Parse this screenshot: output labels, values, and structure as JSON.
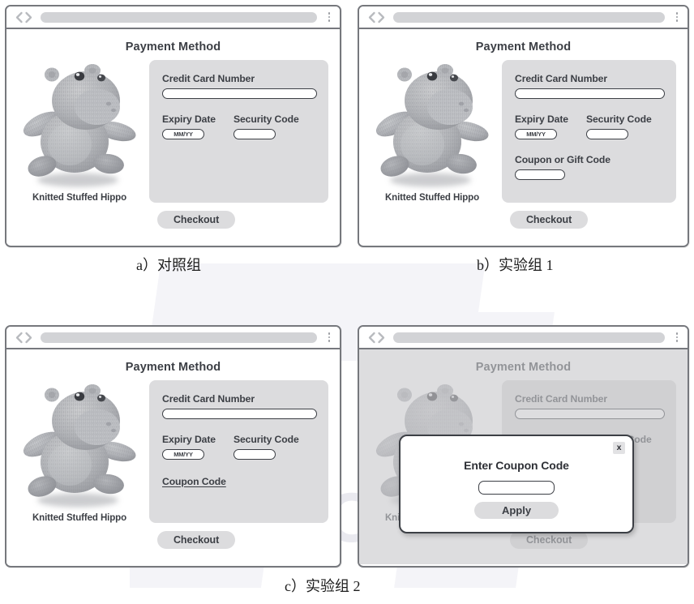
{
  "figure": {
    "captions": {
      "a": "a）对照组",
      "b": "b）实验组 1",
      "c": "c）实验组 2"
    },
    "watermark": "HZ BOOKS"
  },
  "browser": {
    "back_icon": "chevron-left-icon",
    "forward_icon": "chevron-right-icon",
    "url_value": "",
    "menu_icon": "kebab-menu-icon"
  },
  "common": {
    "page_title": "Payment Method",
    "product_caption": "Knitted Stuffed Hippo",
    "product_image": "knitted-stuffed-hippo-photo",
    "checkout_label": "Checkout",
    "credit_card_label": "Credit Card Number",
    "expiry_label": "Expiry Date",
    "expiry_placeholder": "MM/YY",
    "security_label": "Security Code",
    "card_value": "",
    "expiry_value": "",
    "security_value": ""
  },
  "panel_a": {
    "id": "control-group"
  },
  "panel_b": {
    "id": "experiment-group-1",
    "coupon_label": "Coupon or Gift Code",
    "coupon_value": ""
  },
  "panel_c": {
    "id": "experiment-group-2",
    "coupon_link_label": "Coupon Code"
  },
  "panel_d": {
    "id": "experiment-group-2-modal",
    "modal_title": "Enter Coupon Code",
    "modal_close_label": "x",
    "modal_input_value": "",
    "modal_apply_label": "Apply"
  },
  "colors": {
    "window_border": "#76787d",
    "card_bg": "#dcdcde",
    "text": "#3c3f45",
    "urlbar": "#d2d3d6",
    "watermark": "#e9e9ef"
  }
}
